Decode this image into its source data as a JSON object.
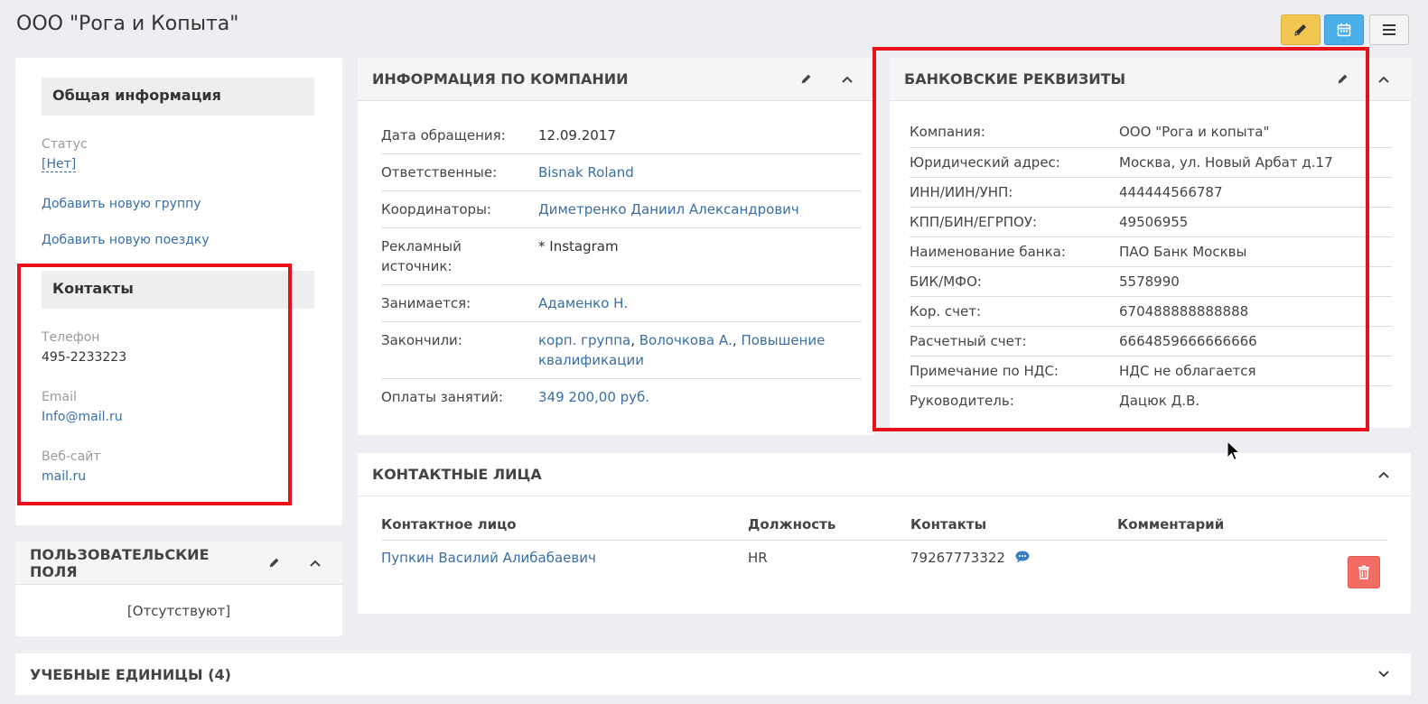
{
  "page": {
    "title": "ООО \"Рога и Копыта\""
  },
  "toolbar": {
    "edit_icon": "pencil-icon",
    "calendar_icon": "calendar-icon",
    "menu_icon": "hamburger-menu-icon",
    "edit_color": "#f0c550",
    "calendar_color": "#4aaee8"
  },
  "left_panel": {
    "general_title": "Общая информация",
    "status_label": "Статус",
    "status_value": "[Нет]",
    "add_group_link": "Добавить новую группу",
    "add_trip_link": "Добавить новую поездку",
    "contacts_title": "Контакты",
    "phone_label": "Телефон",
    "phone_value": "495-2233223",
    "email_label": "Email",
    "email_value": "Info@mail.ru",
    "website_label": "Веб-сайт",
    "website_value": "mail.ru"
  },
  "custom_fields": {
    "title": "ПОЛЬЗОВАТЕЛЬСКИЕ ПОЛЯ",
    "empty_text": "[Отсутствуют]"
  },
  "company_info": {
    "title": "ИНФОРМАЦИЯ ПО КОМПАНИИ",
    "rows": [
      {
        "label": "Дата обращения:",
        "value": "12.09.2017"
      },
      {
        "label": "Ответственные:",
        "value": "Bisnak Roland"
      },
      {
        "label": "Координаторы:",
        "value": "Диметренко Даниил Александрович"
      },
      {
        "label": "Рекламный источник:",
        "value": "* Instagram"
      },
      {
        "label": "Занимается:",
        "value": "Адаменко Н."
      },
      {
        "label": "Закончили:",
        "value1": "корп. группа",
        "sep1": ", ",
        "value2": "Волочкова А.",
        "sep2": ", ",
        "value3": "Повышение квалификации"
      },
      {
        "label": "Оплаты занятий:",
        "value": "349 200,00 руб."
      }
    ]
  },
  "bank_details": {
    "title": "БАНКОВСКИЕ РЕКВИЗИТЫ",
    "rows": [
      {
        "label": "Компания:",
        "value": "ООО \"Рога и копыта\""
      },
      {
        "label": "Юридический адрес:",
        "value": "Москва, ул. Новый Арбат д.17"
      },
      {
        "label": "ИНН/ИИН/УНП:",
        "value": "444444566787"
      },
      {
        "label": "КПП/БИН/ЕГРПОУ:",
        "value": "49506955"
      },
      {
        "label": "Наименование банка:",
        "value": "ПАО Банк Москвы"
      },
      {
        "label": "БИК/МФО:",
        "value": "5578990"
      },
      {
        "label": "Кор. счет:",
        "value": "670488888888888"
      },
      {
        "label": "Расчетный счет:",
        "value": "6664859666666666"
      },
      {
        "label": "Примечание по НДС:",
        "value": "НДС не облагается"
      },
      {
        "label": "Руководитель:",
        "value": "Дацюк Д.В."
      }
    ]
  },
  "contact_persons": {
    "title": "КОНТАКТНЫЕ ЛИЦА",
    "columns": [
      "Контактное лицо",
      "Должность",
      "Контакты",
      "Комментарий"
    ],
    "rows": [
      {
        "name": "Пупкин Василий Алибабаевич",
        "position": "HR",
        "contacts": "79267773322",
        "comment": ""
      }
    ],
    "sms_icon": "sms-chat-icon",
    "delete_icon": "trash-icon",
    "delete_color": "#f26c64"
  },
  "learning_units": {
    "title": "УЧЕБНЫЕ ЕДИНИЦЫ (4)"
  },
  "annotation_color": "#e8101b"
}
